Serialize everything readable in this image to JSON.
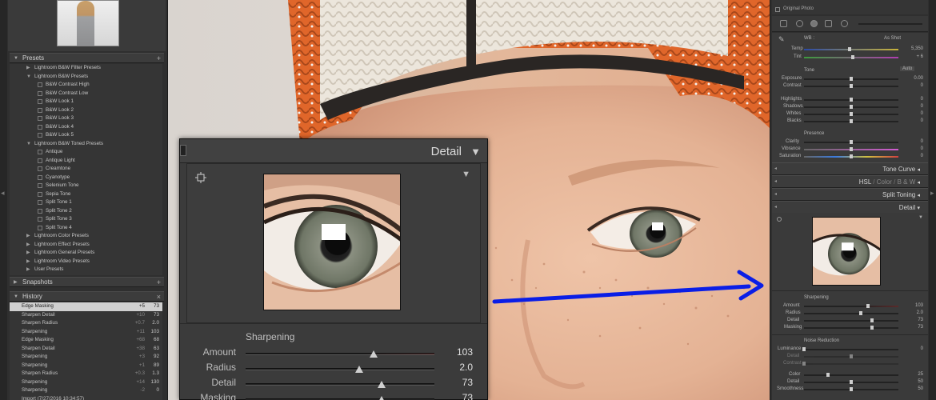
{
  "left": {
    "presets_header": "Presets",
    "presets": [
      {
        "kind": "folder",
        "label": "Lightroom B&W Filter Presets",
        "open": false
      },
      {
        "kind": "folder",
        "label": "Lightroom B&W Presets",
        "open": true
      },
      {
        "kind": "item",
        "label": "B&W Contrast High"
      },
      {
        "kind": "item",
        "label": "B&W Contrast Low"
      },
      {
        "kind": "item",
        "label": "B&W Look 1"
      },
      {
        "kind": "item",
        "label": "B&W Look 2"
      },
      {
        "kind": "item",
        "label": "B&W Look 3"
      },
      {
        "kind": "item",
        "label": "B&W Look 4"
      },
      {
        "kind": "item",
        "label": "B&W Look 5"
      },
      {
        "kind": "folder",
        "label": "Lightroom B&W Toned Presets",
        "open": true
      },
      {
        "kind": "item",
        "label": "Antique"
      },
      {
        "kind": "item",
        "label": "Antique Light"
      },
      {
        "kind": "item",
        "label": "Creamtone"
      },
      {
        "kind": "item",
        "label": "Cyanotype"
      },
      {
        "kind": "item",
        "label": "Selenium Tone"
      },
      {
        "kind": "item",
        "label": "Sepia Tone"
      },
      {
        "kind": "item",
        "label": "Split Tone 1"
      },
      {
        "kind": "item",
        "label": "Split Tone 2"
      },
      {
        "kind": "item",
        "label": "Split Tone 3"
      },
      {
        "kind": "item",
        "label": "Split Tone 4"
      },
      {
        "kind": "folder",
        "label": "Lightroom Color Presets",
        "open": false
      },
      {
        "kind": "folder",
        "label": "Lightroom Effect Presets",
        "open": false
      },
      {
        "kind": "folder",
        "label": "Lightroom General Presets",
        "open": false
      },
      {
        "kind": "folder",
        "label": "Lightroom Video Presets",
        "open": false
      },
      {
        "kind": "folder",
        "label": "User Presets",
        "open": false
      }
    ],
    "snapshots_header": "Snapshots",
    "history_header": "History",
    "history": [
      {
        "label": "Edge Masking",
        "delta": "+5",
        "value": "73",
        "selected": true
      },
      {
        "label": "Sharpen Detail",
        "delta": "+10",
        "value": "73",
        "selected": false
      },
      {
        "label": "Sharpen Radius",
        "delta": "+0.7",
        "value": "2.0",
        "selected": false
      },
      {
        "label": "Sharpening",
        "delta": "+11",
        "value": "103",
        "selected": false
      },
      {
        "label": "Edge Masking",
        "delta": "+68",
        "value": "68",
        "selected": false
      },
      {
        "label": "Sharpen Detail",
        "delta": "+38",
        "value": "63",
        "selected": false
      },
      {
        "label": "Sharpening",
        "delta": "+3",
        "value": "92",
        "selected": false
      },
      {
        "label": "Sharpening",
        "delta": "+1",
        "value": "89",
        "selected": false
      },
      {
        "label": "Sharpen Radius",
        "delta": "+0.3",
        "value": "1.3",
        "selected": false
      },
      {
        "label": "Sharpening",
        "delta": "+14",
        "value": "130",
        "selected": false
      },
      {
        "label": "Sharpening",
        "delta": "-2",
        "value": "0",
        "selected": false
      },
      {
        "label": "Import (7/27/2016 10:34:57)",
        "delta": "",
        "value": "",
        "selected": false
      }
    ]
  },
  "detail_overlay": {
    "title": "Detail",
    "sharpening_label": "Sharpening",
    "sliders": [
      {
        "label": "Amount",
        "value": "103",
        "position": 0.68
      },
      {
        "label": "Radius",
        "value": "2.0",
        "position": 0.6
      },
      {
        "label": "Detail",
        "value": "73",
        "position": 0.72
      },
      {
        "label": "Masking",
        "value": "73",
        "position": 0.72
      }
    ]
  },
  "right": {
    "original_photo_label": "Original Photo",
    "wb_label": "WB :",
    "wb_value": "As Shot",
    "temp_label": "Temp",
    "temp_value": "5,350",
    "tint_label": "Tint",
    "tint_value": "+ 6",
    "tone_label": "Tone",
    "auto_label": "Auto",
    "exposure_label": "Exposure",
    "exposure_value": "0.00",
    "contrast_label": "Contrast",
    "contrast_value": "0",
    "highlights_label": "Highlights",
    "highlights_value": "0",
    "shadows_label": "Shadows",
    "shadows_value": "0",
    "whites_label": "Whites",
    "whites_value": "0",
    "blacks_label": "Blacks",
    "blacks_value": "0",
    "presence_label": "Presence",
    "clarity_label": "Clarity",
    "clarity_value": "0",
    "vibrance_label": "Vibrance",
    "vibrance_value": "0",
    "saturation_label": "Saturation",
    "saturation_value": "0",
    "tone_curve_header": "Tone Curve",
    "hsl_header": "HSL",
    "hsl_color": "Color",
    "hsl_bw": "B & W",
    "hsl_sep": "/",
    "split_toning_header": "Split Toning",
    "detail_header": "Detail",
    "sharpening_label": "Sharpening",
    "amount_label": "Amount",
    "amount_value": "103",
    "radius_label": "Radius",
    "radius_value": "2.0",
    "detail_label": "Detail",
    "detail_value": "73",
    "masking_label": "Masking",
    "masking_value": "73",
    "noise_label": "Noise Reduction",
    "luminance_label": "Luminance",
    "luminance_value": "0",
    "nr_detail_label": "Detail",
    "nr_contrast_label": "Contrast",
    "color_label": "Color",
    "color_value": "25",
    "color_detail_label": "Detail",
    "color_detail_value": "50",
    "smoothness_label": "Smoothness",
    "smoothness_value": "50"
  },
  "colors": {
    "annotation_arrow": "#0a1ee6",
    "selected_row": "#cfcfcf"
  }
}
